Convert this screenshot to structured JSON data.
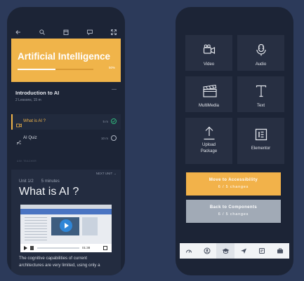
{
  "colors": {
    "background": "#2c3a5a",
    "phone": "#1c2436",
    "accent": "#f0b44a",
    "success": "#2fb67c",
    "secondary_button": "#a1aab6"
  },
  "left_screen": {
    "topbar_icons": [
      "back-arrow-icon",
      "search-icon",
      "bookmark-icon",
      "chat-icon",
      "expand-icon"
    ],
    "hero": {
      "title": "Artificial Intelligence",
      "progress_label": "50%",
      "progress": 0.5
    },
    "course": {
      "title": "Introduction to AI",
      "meta": "2 Lessons, 15 m"
    },
    "lessons": [
      {
        "label": "What is AI ?",
        "time": "5 m",
        "icon": "video-icon",
        "status": "completed"
      },
      {
        "label": "AI Quiz",
        "time": "10 m",
        "icon": "quiz-icon",
        "status": "not-started"
      }
    ],
    "ask_teacher": "ASK TEACHER",
    "lesson": {
      "next_unit": "NEXT UNIT",
      "unit": "Unit 1/2",
      "duration": "5 minutes",
      "heading": "What is AI ?",
      "video_time": "01:38",
      "text_line1": "The cognitive capabilities of current",
      "text_line2": "architectures are very limited, using only a"
    }
  },
  "right_screen": {
    "tiles": [
      {
        "label": "Video",
        "icon": "video-camera-icon"
      },
      {
        "label": "Audio",
        "icon": "microphone-icon"
      },
      {
        "label": "MultiMedia",
        "icon": "clapperboard-icon"
      },
      {
        "label": "Text",
        "icon": "text-icon"
      },
      {
        "label_line1": "Upload",
        "label_line2": "Package",
        "icon": "upload-icon"
      },
      {
        "label": "Elementor",
        "icon": "elementor-icon"
      }
    ],
    "buttons": {
      "accessibility": {
        "label": "Move to Accessibility",
        "count": "6 / 5 changes"
      },
      "components": {
        "label": "Back to Components",
        "count": "6 / 5 changes"
      }
    },
    "bottom_nav": [
      "dashboard-icon",
      "profile-icon",
      "courses-icon",
      "send-icon",
      "notes-icon",
      "briefcase-icon"
    ],
    "active_nav": "courses-icon"
  }
}
